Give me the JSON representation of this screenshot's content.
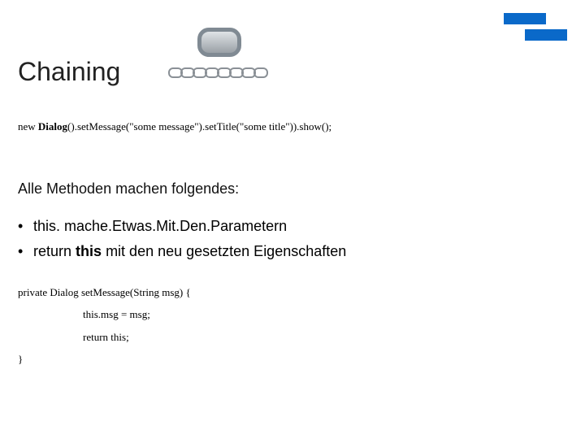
{
  "title": "Chaining",
  "code_top": {
    "prefix": "new ",
    "class": "Dialog",
    "rest": "().setMessage(\"some message\").setTitle(\"some title\")).show();"
  },
  "subhead": "Alle Methoden machen folgendes:",
  "bullets": {
    "b1": "this. mache.Etwas.Mit.Den.Parametern",
    "b2_pre": "return ",
    "b2_kw": "this",
    "b2_post": " mit den neu gesetzten Eigenschaften"
  },
  "code_method": {
    "line1": "private Dialog setMessage(String msg) {",
    "line2": "this.msg = msg;",
    "line3": "return this;",
    "line4": "}"
  }
}
